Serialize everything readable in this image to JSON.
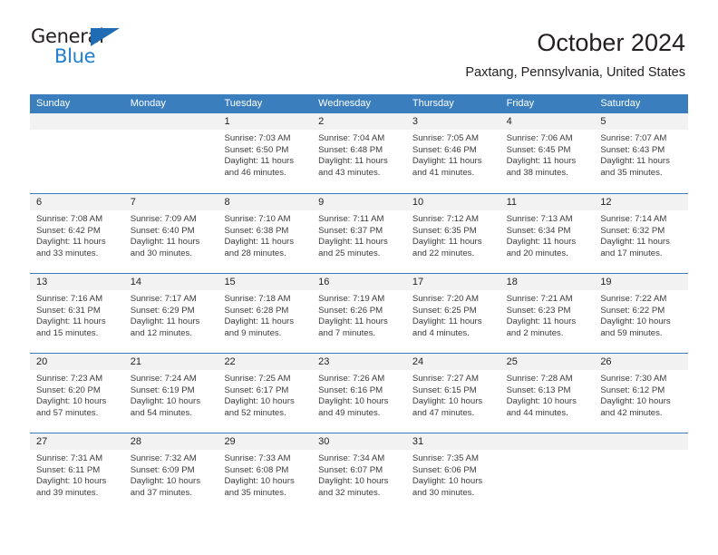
{
  "logo": {
    "word_top": "General",
    "word_bottom": "Blue",
    "triangle_color": "#1f6cb4",
    "blue_color": "#1f7fd0"
  },
  "header": {
    "title": "October 2024",
    "subtitle": "Paxtang, Pennsylvania, United States"
  },
  "theme": {
    "header_blue": "#3a7ebe",
    "day_strip_gray": "#f2f2f2",
    "text": "#231f20"
  },
  "weekdays": [
    "Sunday",
    "Monday",
    "Tuesday",
    "Wednesday",
    "Thursday",
    "Friday",
    "Saturday"
  ],
  "weeks": [
    [
      {
        "day": "",
        "lines": []
      },
      {
        "day": "",
        "lines": []
      },
      {
        "day": "1",
        "lines": [
          "Sunrise: 7:03 AM",
          "Sunset: 6:50 PM",
          "Daylight: 11 hours",
          "and 46 minutes."
        ]
      },
      {
        "day": "2",
        "lines": [
          "Sunrise: 7:04 AM",
          "Sunset: 6:48 PM",
          "Daylight: 11 hours",
          "and 43 minutes."
        ]
      },
      {
        "day": "3",
        "lines": [
          "Sunrise: 7:05 AM",
          "Sunset: 6:46 PM",
          "Daylight: 11 hours",
          "and 41 minutes."
        ]
      },
      {
        "day": "4",
        "lines": [
          "Sunrise: 7:06 AM",
          "Sunset: 6:45 PM",
          "Daylight: 11 hours",
          "and 38 minutes."
        ]
      },
      {
        "day": "5",
        "lines": [
          "Sunrise: 7:07 AM",
          "Sunset: 6:43 PM",
          "Daylight: 11 hours",
          "and 35 minutes."
        ]
      }
    ],
    [
      {
        "day": "6",
        "lines": [
          "Sunrise: 7:08 AM",
          "Sunset: 6:42 PM",
          "Daylight: 11 hours",
          "and 33 minutes."
        ]
      },
      {
        "day": "7",
        "lines": [
          "Sunrise: 7:09 AM",
          "Sunset: 6:40 PM",
          "Daylight: 11 hours",
          "and 30 minutes."
        ]
      },
      {
        "day": "8",
        "lines": [
          "Sunrise: 7:10 AM",
          "Sunset: 6:38 PM",
          "Daylight: 11 hours",
          "and 28 minutes."
        ]
      },
      {
        "day": "9",
        "lines": [
          "Sunrise: 7:11 AM",
          "Sunset: 6:37 PM",
          "Daylight: 11 hours",
          "and 25 minutes."
        ]
      },
      {
        "day": "10",
        "lines": [
          "Sunrise: 7:12 AM",
          "Sunset: 6:35 PM",
          "Daylight: 11 hours",
          "and 22 minutes."
        ]
      },
      {
        "day": "11",
        "lines": [
          "Sunrise: 7:13 AM",
          "Sunset: 6:34 PM",
          "Daylight: 11 hours",
          "and 20 minutes."
        ]
      },
      {
        "day": "12",
        "lines": [
          "Sunrise: 7:14 AM",
          "Sunset: 6:32 PM",
          "Daylight: 11 hours",
          "and 17 minutes."
        ]
      }
    ],
    [
      {
        "day": "13",
        "lines": [
          "Sunrise: 7:16 AM",
          "Sunset: 6:31 PM",
          "Daylight: 11 hours",
          "and 15 minutes."
        ]
      },
      {
        "day": "14",
        "lines": [
          "Sunrise: 7:17 AM",
          "Sunset: 6:29 PM",
          "Daylight: 11 hours",
          "and 12 minutes."
        ]
      },
      {
        "day": "15",
        "lines": [
          "Sunrise: 7:18 AM",
          "Sunset: 6:28 PM",
          "Daylight: 11 hours",
          "and 9 minutes."
        ]
      },
      {
        "day": "16",
        "lines": [
          "Sunrise: 7:19 AM",
          "Sunset: 6:26 PM",
          "Daylight: 11 hours",
          "and 7 minutes."
        ]
      },
      {
        "day": "17",
        "lines": [
          "Sunrise: 7:20 AM",
          "Sunset: 6:25 PM",
          "Daylight: 11 hours",
          "and 4 minutes."
        ]
      },
      {
        "day": "18",
        "lines": [
          "Sunrise: 7:21 AM",
          "Sunset: 6:23 PM",
          "Daylight: 11 hours",
          "and 2 minutes."
        ]
      },
      {
        "day": "19",
        "lines": [
          "Sunrise: 7:22 AM",
          "Sunset: 6:22 PM",
          "Daylight: 10 hours",
          "and 59 minutes."
        ]
      }
    ],
    [
      {
        "day": "20",
        "lines": [
          "Sunrise: 7:23 AM",
          "Sunset: 6:20 PM",
          "Daylight: 10 hours",
          "and 57 minutes."
        ]
      },
      {
        "day": "21",
        "lines": [
          "Sunrise: 7:24 AM",
          "Sunset: 6:19 PM",
          "Daylight: 10 hours",
          "and 54 minutes."
        ]
      },
      {
        "day": "22",
        "lines": [
          "Sunrise: 7:25 AM",
          "Sunset: 6:17 PM",
          "Daylight: 10 hours",
          "and 52 minutes."
        ]
      },
      {
        "day": "23",
        "lines": [
          "Sunrise: 7:26 AM",
          "Sunset: 6:16 PM",
          "Daylight: 10 hours",
          "and 49 minutes."
        ]
      },
      {
        "day": "24",
        "lines": [
          "Sunrise: 7:27 AM",
          "Sunset: 6:15 PM",
          "Daylight: 10 hours",
          "and 47 minutes."
        ]
      },
      {
        "day": "25",
        "lines": [
          "Sunrise: 7:28 AM",
          "Sunset: 6:13 PM",
          "Daylight: 10 hours",
          "and 44 minutes."
        ]
      },
      {
        "day": "26",
        "lines": [
          "Sunrise: 7:30 AM",
          "Sunset: 6:12 PM",
          "Daylight: 10 hours",
          "and 42 minutes."
        ]
      }
    ],
    [
      {
        "day": "27",
        "lines": [
          "Sunrise: 7:31 AM",
          "Sunset: 6:11 PM",
          "Daylight: 10 hours",
          "and 39 minutes."
        ]
      },
      {
        "day": "28",
        "lines": [
          "Sunrise: 7:32 AM",
          "Sunset: 6:09 PM",
          "Daylight: 10 hours",
          "and 37 minutes."
        ]
      },
      {
        "day": "29",
        "lines": [
          "Sunrise: 7:33 AM",
          "Sunset: 6:08 PM",
          "Daylight: 10 hours",
          "and 35 minutes."
        ]
      },
      {
        "day": "30",
        "lines": [
          "Sunrise: 7:34 AM",
          "Sunset: 6:07 PM",
          "Daylight: 10 hours",
          "and 32 minutes."
        ]
      },
      {
        "day": "31",
        "lines": [
          "Sunrise: 7:35 AM",
          "Sunset: 6:06 PM",
          "Daylight: 10 hours",
          "and 30 minutes."
        ]
      },
      {
        "day": "",
        "lines": []
      },
      {
        "day": "",
        "lines": []
      }
    ]
  ]
}
